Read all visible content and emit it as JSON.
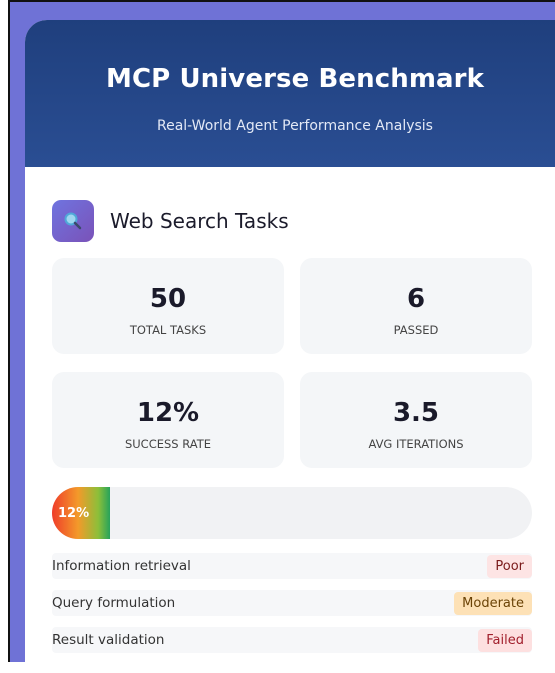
{
  "header": {
    "title": "MCP Universe Benchmark",
    "subtitle": "Real-World Agent Performance Analysis"
  },
  "section": {
    "icon": "search-icon",
    "title": "Web Search Tasks"
  },
  "stats": [
    {
      "value": "50",
      "label": "TOTAL TASKS"
    },
    {
      "value": "6",
      "label": "PASSED"
    },
    {
      "value": "12%",
      "label": "SUCCESS RATE"
    },
    {
      "value": "3.5",
      "label": "AVG ITERATIONS"
    }
  ],
  "progress": {
    "label": "12%",
    "fraction": 0.12
  },
  "capabilities": [
    {
      "label": "Information retrieval",
      "status": "Poor",
      "status_color": "#fde4e4"
    },
    {
      "label": "Query formulation",
      "status": "Moderate",
      "status_color": "#fde1b6"
    },
    {
      "label": "Result validation",
      "status": "Failed",
      "status_color": "#fde0e0"
    }
  ]
}
